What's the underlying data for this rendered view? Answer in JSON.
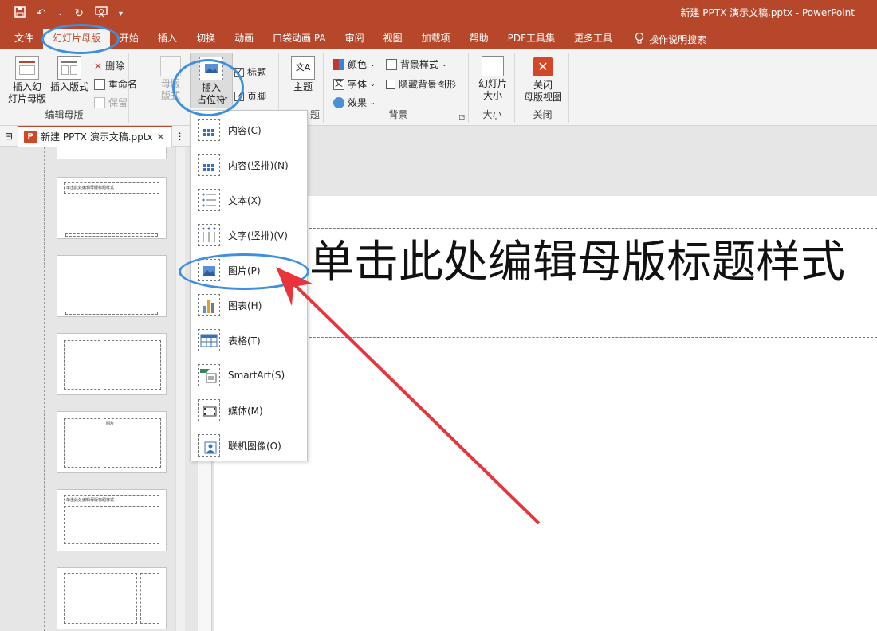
{
  "app": {
    "window_title": "新建 PPTX 演示文稿.pptx  -  PowerPoint"
  },
  "qat": {
    "save_icon": "save-icon",
    "undo_icon": "undo-icon",
    "redo_icon": "redo-icon",
    "slideshow_icon": "present-icon",
    "customize_icon": "customize-qat-icon"
  },
  "tabs": [
    {
      "label": "文件"
    },
    {
      "label": "幻灯片母版"
    },
    {
      "label": "开始"
    },
    {
      "label": "插入"
    },
    {
      "label": "切换"
    },
    {
      "label": "动画"
    },
    {
      "label": "口袋动画 PA"
    },
    {
      "label": "审阅"
    },
    {
      "label": "视图"
    },
    {
      "label": "加载项"
    },
    {
      "label": "帮助"
    },
    {
      "label": "PDF工具集"
    },
    {
      "label": "更多工具"
    }
  ],
  "tell_me": "操作说明搜索",
  "ribbon": {
    "edit_master": {
      "label": "编辑母版",
      "insert_slide_master": "插入幻\n灯片母版",
      "insert_layout": "插入版式",
      "delete": "删除",
      "rename": "重命名",
      "preserve": "保留"
    },
    "master_layout": {
      "master_layout_btn": "母版\n版式",
      "insert_placeholder": "插入\n占位符",
      "title_chk": "标题",
      "footer_chk": "页脚"
    },
    "edit_theme": {
      "theme": "主题",
      "label": "题"
    },
    "background": {
      "label": "背景",
      "colors": "颜色",
      "fonts": "字体",
      "effects": "效果",
      "bg_styles": "背景样式",
      "hide_bg": "隐藏背景图形"
    },
    "size": {
      "label": "大小",
      "slide_size": "幻灯片\n大小"
    },
    "close": {
      "label": "关闭",
      "close_master": "关闭\n母版视图"
    }
  },
  "document_tab": {
    "name": "新建 PPTX 演示文稿.pptx"
  },
  "placeholder_menu": [
    {
      "label": "内容(C)",
      "icon": "content-placeholder-icon"
    },
    {
      "label": "内容(竖排)(N)",
      "icon": "vertical-content-placeholder-icon"
    },
    {
      "label": "文本(X)",
      "icon": "text-placeholder-icon"
    },
    {
      "label": "文字(竖排)(V)",
      "icon": "vertical-text-placeholder-icon"
    },
    {
      "label": "图片(P)",
      "icon": "picture-placeholder-icon"
    },
    {
      "label": "图表(H)",
      "icon": "chart-placeholder-icon"
    },
    {
      "label": "表格(T)",
      "icon": "table-placeholder-icon"
    },
    {
      "label": "SmartArt(S)",
      "icon": "smartart-placeholder-icon"
    },
    {
      "label": "媒体(M)",
      "icon": "media-placeholder-icon"
    },
    {
      "label": "联机图像(O)",
      "icon": "online-image-placeholder-icon"
    }
  ],
  "slide": {
    "title": "单击此处编辑母版标题样式"
  },
  "thumbnails": {
    "title_text": "单击此处编辑母版标题样式",
    "picture_label": "图片"
  },
  "annotation_color": "#3d8fe0",
  "arrow_color": "#e8343a"
}
